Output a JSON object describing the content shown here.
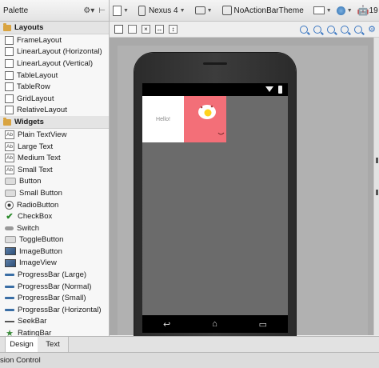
{
  "palette": {
    "title": "Palette",
    "header_icons": [
      "gear-icon",
      "collapse-icon"
    ],
    "categories": [
      {
        "label": "Layouts",
        "items": [
          {
            "label": "FrameLayout",
            "icon": "box-icon"
          },
          {
            "label": "LinearLayout (Horizontal)",
            "icon": "box-icon"
          },
          {
            "label": "LinearLayout (Vertical)",
            "icon": "box-icon"
          },
          {
            "label": "TableLayout",
            "icon": "box-icon"
          },
          {
            "label": "TableRow",
            "icon": "box-icon"
          },
          {
            "label": "GridLayout",
            "icon": "box-icon"
          },
          {
            "label": "RelativeLayout",
            "icon": "box-icon"
          }
        ]
      },
      {
        "label": "Widgets",
        "items": [
          {
            "label": "Plain TextView",
            "icon": "ab-icon"
          },
          {
            "label": "Large Text",
            "icon": "ab-icon"
          },
          {
            "label": "Medium Text",
            "icon": "ab-icon"
          },
          {
            "label": "Small Text",
            "icon": "ab-icon"
          },
          {
            "label": "Button",
            "icon": "button-icon"
          },
          {
            "label": "Small Button",
            "icon": "button-icon"
          },
          {
            "label": "RadioButton",
            "icon": "radio-icon"
          },
          {
            "label": "CheckBox",
            "icon": "check-icon"
          },
          {
            "label": "Switch",
            "icon": "switch-icon"
          },
          {
            "label": "ToggleButton",
            "icon": "button-icon"
          },
          {
            "label": "ImageButton",
            "icon": "image-icon"
          },
          {
            "label": "ImageView",
            "icon": "image-icon"
          },
          {
            "label": "ProgressBar (Large)",
            "icon": "progress-icon"
          },
          {
            "label": "ProgressBar (Normal)",
            "icon": "progress-icon"
          },
          {
            "label": "ProgressBar (Small)",
            "icon": "progress-icon"
          },
          {
            "label": "ProgressBar (Horizontal)",
            "icon": "progress-icon"
          },
          {
            "label": "SeekBar",
            "icon": "seek-icon"
          },
          {
            "label": "RatingBar",
            "icon": "star-icon"
          }
        ]
      }
    ]
  },
  "toolbar": {
    "device": "Nexus 4",
    "theme": "NoActionBarTheme",
    "api": "19"
  },
  "preview": {
    "hello_text": "Hello!",
    "image_color": "#f36f78"
  },
  "bottom_tabs": [
    {
      "label": "Design",
      "selected": true
    },
    {
      "label": "Text",
      "selected": false
    }
  ],
  "status_bar": {
    "label": "sion Control"
  }
}
